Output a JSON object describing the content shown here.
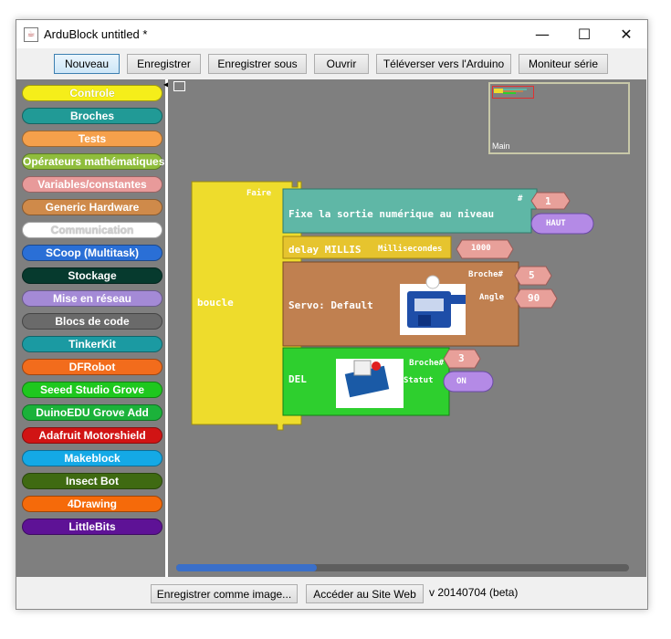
{
  "window": {
    "title": "ArduBlock untitled *",
    "minimize_glyph": "—",
    "maximize_glyph": "☐",
    "close_glyph": "✕"
  },
  "toolbar": {
    "buttons": [
      {
        "label": "Nouveau"
      },
      {
        "label": "Enregistrer"
      },
      {
        "label": "Enregistrer sous"
      },
      {
        "label": "Ouvrir"
      },
      {
        "label": "Téléverser vers l'Arduino"
      },
      {
        "label": "Moniteur série"
      }
    ]
  },
  "palette": {
    "items": [
      {
        "label": "Controle",
        "color": "#f5ee1a"
      },
      {
        "label": "Broches",
        "color": "#219a96"
      },
      {
        "label": "Tests",
        "color": "#f5a04b"
      },
      {
        "label": "Opérateurs mathématiques",
        "color": "#8fbd3c"
      },
      {
        "label": "Variables/constantes",
        "color": "#e89a9a"
      },
      {
        "label": "Generic Hardware",
        "color": "#cf8a4a"
      },
      {
        "label": "Communication",
        "color": "#ffffff"
      },
      {
        "label": "SCoop (Multitask)",
        "color": "#2a6fd6"
      },
      {
        "label": "Stockage",
        "color": "#063a2e"
      },
      {
        "label": "Mise en réseau",
        "color": "#a48ad6"
      },
      {
        "label": "Blocs de code",
        "color": "#6a6a6a"
      },
      {
        "label": "TinkerKit",
        "color": "#1b9aa2"
      },
      {
        "label": "DFRobot",
        "color": "#f26c1c"
      },
      {
        "label": "Seeed Studio Grove",
        "color": "#1ec81e"
      },
      {
        "label": "DuinoEDU Grove Add",
        "color": "#1bb23a"
      },
      {
        "label": "Adafruit Motorshield",
        "color": "#d11414"
      },
      {
        "label": "Makeblock",
        "color": "#14a9e6"
      },
      {
        "label": "Insect Bot",
        "color": "#3f6a12"
      },
      {
        "label": "4Drawing",
        "color": "#f56a0a"
      },
      {
        "label": "LittleBits",
        "color": "#5e1296"
      }
    ]
  },
  "minimap": {
    "label": "Main"
  },
  "program": {
    "loop": {
      "label": "boucle",
      "slot_label": "Faire",
      "color": "#eedc2c"
    },
    "digital_write": {
      "label": "Fixe la sortie numérique au niveau",
      "pin_label": "#",
      "pin_value": "1",
      "level_value": "HAUT",
      "color": "#5fb7a6"
    },
    "delay": {
      "label": "delay MILLIS",
      "param_label": "Millisecondes",
      "value": "1000",
      "color": "#e6c42e"
    },
    "servo": {
      "label": "Servo: Default",
      "pin_label": "Broche#",
      "pin_value": "5",
      "angle_label": "Angle",
      "angle_value": "90",
      "color": "#c08050"
    },
    "led": {
      "label": "DEL",
      "pin_label": "Broche#",
      "pin_value": "3",
      "status_label": "Statut",
      "status_value": "ON",
      "color": "#2ecf2e"
    }
  },
  "statusbar": {
    "save_image_label": "Enregistrer comme image...",
    "website_label": "Accéder au Site Web",
    "version": "v 20140704 (beta)"
  },
  "colors": {
    "workspace_bg": "#7f7f7f",
    "number_block": "#e8a09a",
    "purple_block": "#b48ae6",
    "scroll_thumb": "#3a6fc9"
  }
}
